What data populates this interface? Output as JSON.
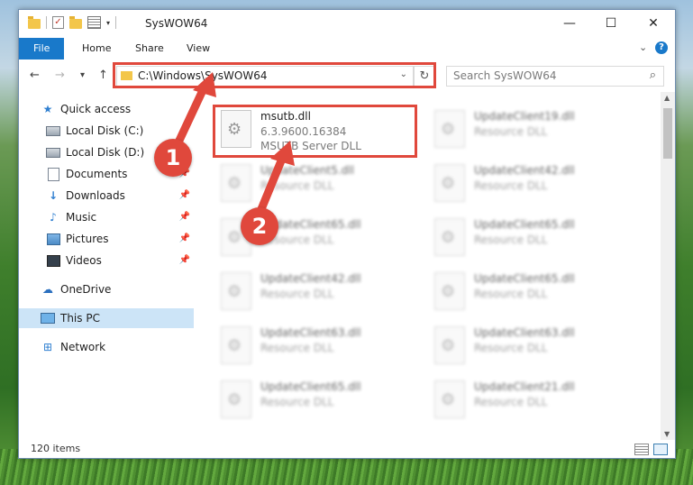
{
  "window": {
    "title": "SysWOW64",
    "controls": {
      "minimize": "—",
      "maximize": "☐",
      "close": "✕"
    }
  },
  "ribbon": {
    "tabs": [
      "File",
      "Home",
      "Share",
      "View"
    ],
    "expand_icon": "chevron-down-icon",
    "help": "?"
  },
  "nav": {
    "back": "←",
    "forward": "→",
    "recent": "▾",
    "up": "↑",
    "address": "C:\\Windows\\SysWOW64",
    "address_dropdown": "⌄",
    "refresh": "↻",
    "search_placeholder": "Search SysWOW64",
    "search_icon": "⌕"
  },
  "sidebar": {
    "items": [
      {
        "label": "Quick access",
        "icon": "star-icon",
        "glyph": "★",
        "pinned": false
      },
      {
        "label": "Local Disk (C:)",
        "icon": "drive-icon",
        "glyph": "",
        "pinned": false
      },
      {
        "label": "Local Disk (D:)",
        "icon": "drive-icon",
        "glyph": "",
        "pinned": false
      },
      {
        "label": "Documents",
        "icon": "documents-icon",
        "glyph": "",
        "pinned": true
      },
      {
        "label": "Downloads",
        "icon": "download-icon",
        "glyph": "🡇",
        "pinned": true
      },
      {
        "label": "Music",
        "icon": "music-icon",
        "glyph": "♪",
        "pinned": true
      },
      {
        "label": "Pictures",
        "icon": "pictures-icon",
        "glyph": "",
        "pinned": true
      },
      {
        "label": "Videos",
        "icon": "videos-icon",
        "glyph": "",
        "pinned": true
      },
      {
        "label": "OneDrive",
        "icon": "onedrive-icon",
        "glyph": "☁",
        "pinned": false
      },
      {
        "label": "This PC",
        "icon": "pc-icon",
        "glyph": "",
        "pinned": false,
        "selected": true
      },
      {
        "label": "Network",
        "icon": "network-icon",
        "glyph": "🖧",
        "pinned": false
      }
    ],
    "pin_glyph": "📌"
  },
  "files": [
    {
      "name": "msutb.dll",
      "version": "6.3.9600.16384",
      "description": "MSUTB Server DLL",
      "highlighted": true
    },
    {
      "name": "UpdateClient19.dll",
      "description": "Resource DLL"
    },
    {
      "name": "UpdateClient5.dll",
      "description": "Resource DLL"
    },
    {
      "name": "UpdateClient42.dll",
      "description": "Resource DLL"
    },
    {
      "name": "UpdateClient65.dll",
      "description": "Resource DLL"
    },
    {
      "name": "UpdateClient65.dll",
      "description": "Resource DLL"
    },
    {
      "name": "UpdateClient42.dll",
      "description": "Resource DLL"
    },
    {
      "name": "UpdateClient65.dll",
      "description": "Resource DLL"
    },
    {
      "name": "UpdateClient63.dll",
      "description": "Resource DLL"
    },
    {
      "name": "UpdateClient63.dll",
      "description": "Resource DLL"
    },
    {
      "name": "UpdateClient65.dll",
      "description": "Resource DLL"
    },
    {
      "name": "UpdateClient21.dll",
      "description": "Resource DLL"
    }
  ],
  "status": {
    "item_count": "120 items"
  },
  "annotations": {
    "step1": "1",
    "step2": "2",
    "color": "#e0483c"
  }
}
